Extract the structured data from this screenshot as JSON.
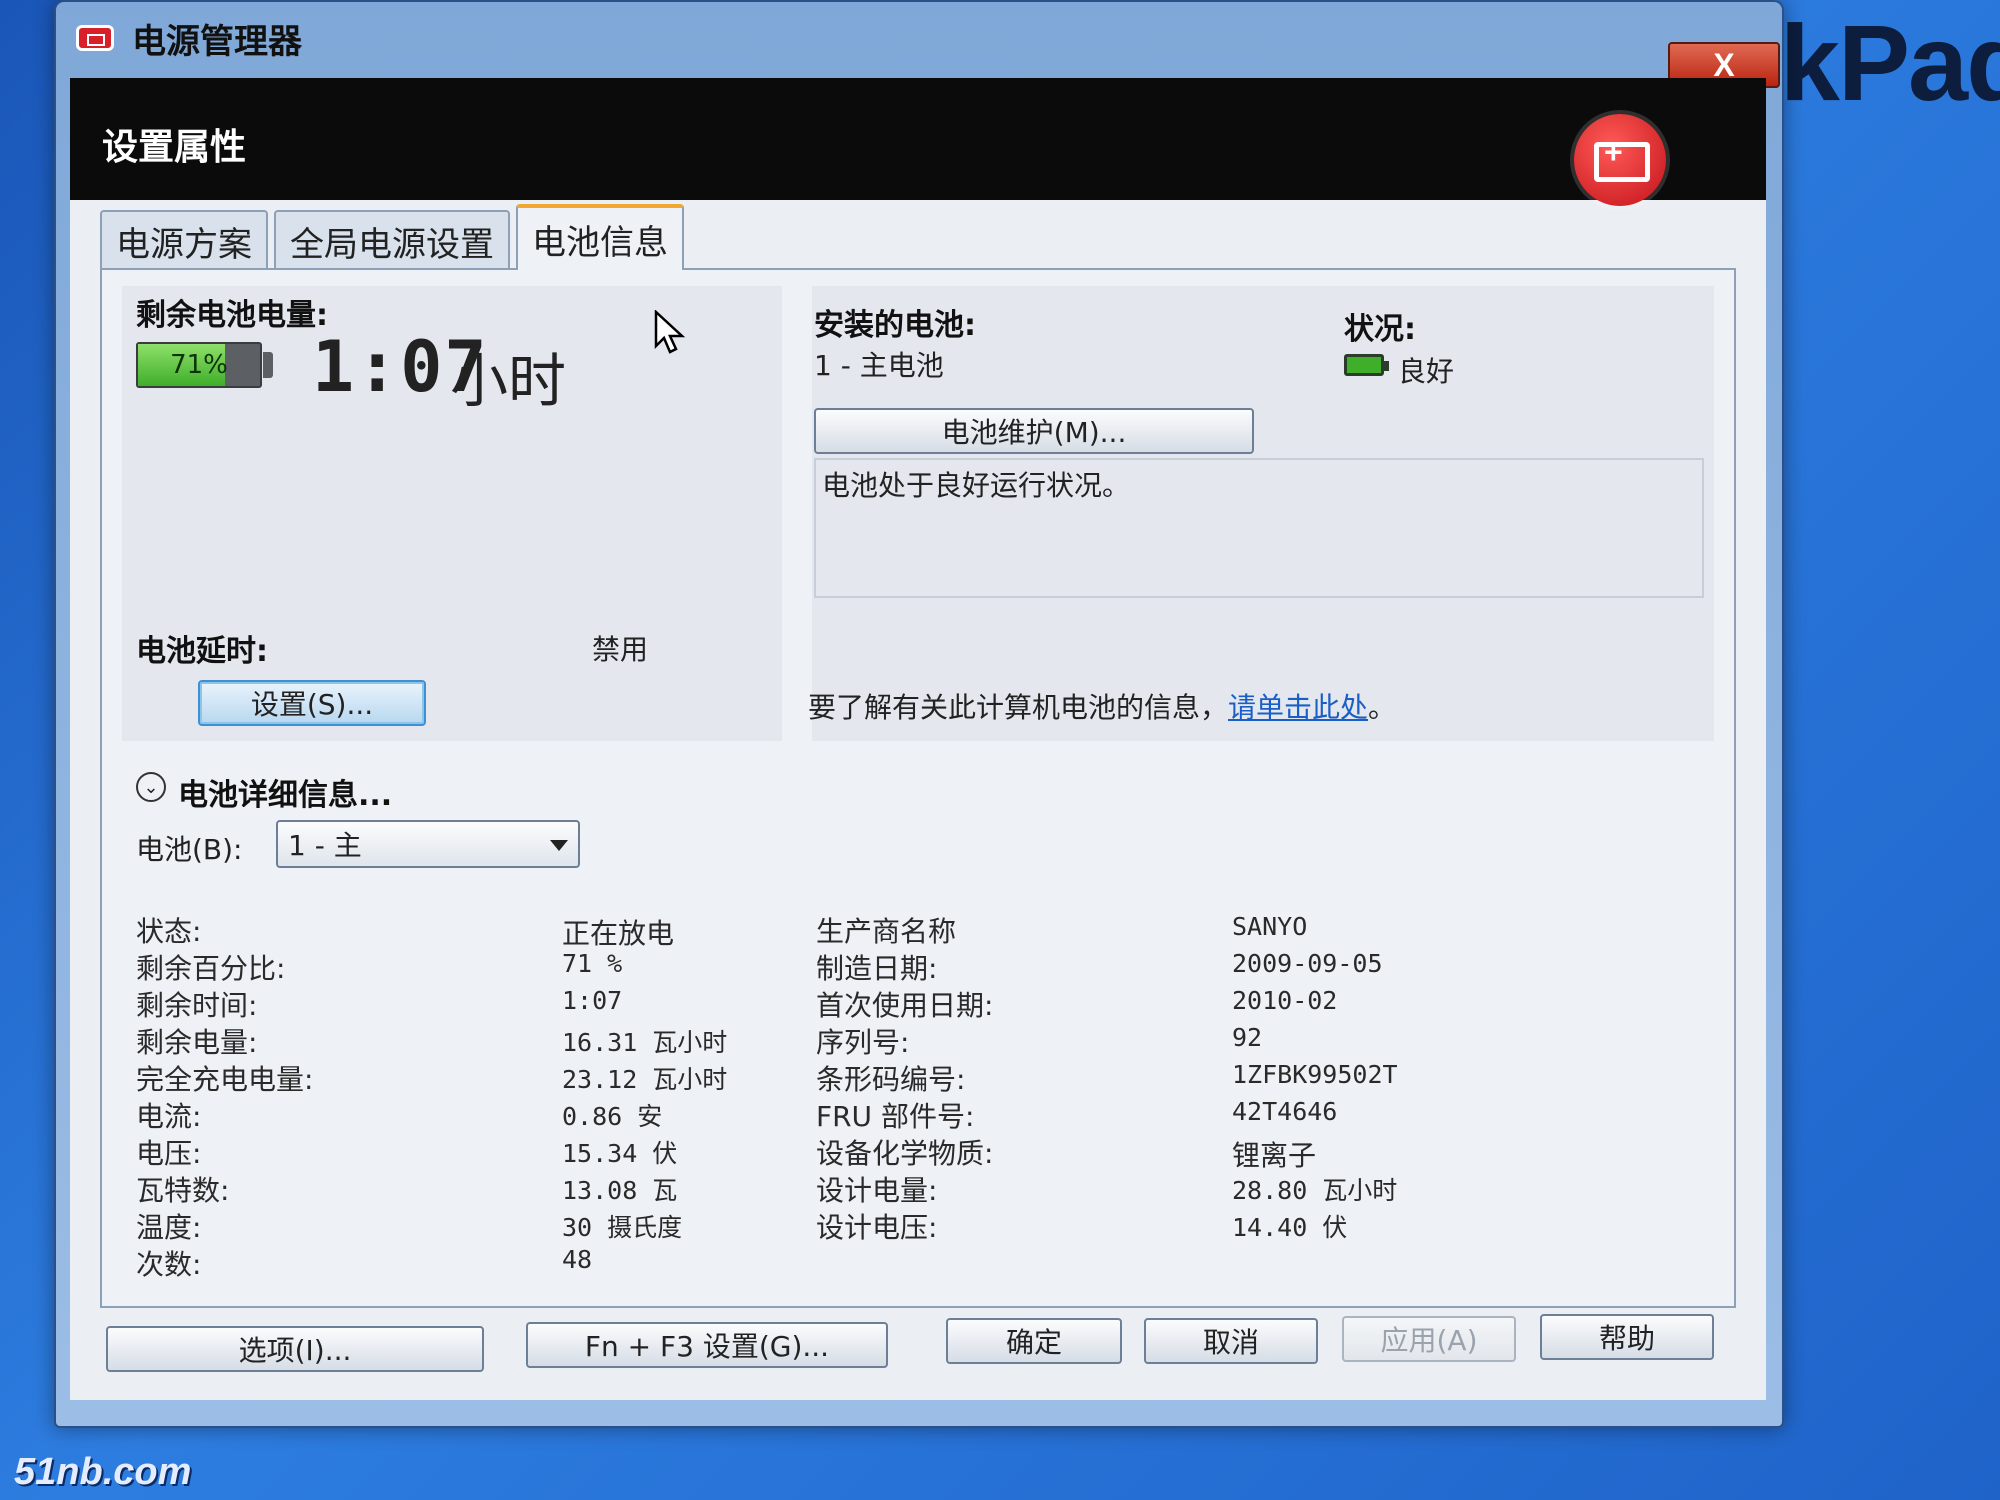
{
  "desktop": {
    "brand_text": "ThinkPad | Th",
    "watermark": "51nb.com"
  },
  "window": {
    "title": "电源管理器",
    "close_label": "X"
  },
  "header": {
    "title": "设置属性"
  },
  "tabs": [
    {
      "label": "电源方案"
    },
    {
      "label": "全局电源设置"
    },
    {
      "label": "电池信息"
    }
  ],
  "remaining": {
    "label": "剩余电池电量:",
    "percent_text": "71%",
    "percent_value": 0.71,
    "time": "1:07",
    "time_unit": "小时"
  },
  "installed": {
    "label": "安装的电池:",
    "value": "1 - 主电池"
  },
  "status": {
    "label": "状况:",
    "value": "良好"
  },
  "maintenance_button": "电池维护(M)...",
  "status_message": "电池处于良好运行状况。",
  "battery_delay": {
    "label": "电池延时:",
    "value": "禁用",
    "settings_button": "设置(S)..."
  },
  "info_link": {
    "prefix": "要了解有关此计算机电池的信息，",
    "link_text": "请单击此处",
    "suffix": "。"
  },
  "details": {
    "title": "电池详细信息...",
    "battery_select_label": "电池(B):",
    "battery_select_value": "1 - 主",
    "left": [
      {
        "k": "状态:",
        "v": "正在放电"
      },
      {
        "k": "剩余百分比:",
        "v": "71 %"
      },
      {
        "k": "剩余时间:",
        "v": "1:07"
      },
      {
        "k": "剩余电量:",
        "v": "16.31 瓦小时"
      },
      {
        "k": "完全充电电量:",
        "v": "23.12 瓦小时"
      },
      {
        "k": "电流:",
        "v": "0.86 安"
      },
      {
        "k": "电压:",
        "v": "15.34 伏"
      },
      {
        "k": "瓦特数:",
        "v": "13.08 瓦"
      },
      {
        "k": "温度:",
        "v": "30 摄氏度"
      },
      {
        "k": "次数:",
        "v": "48"
      }
    ],
    "right": [
      {
        "k": "生产商名称",
        "v": "SANYO"
      },
      {
        "k": "制造日期:",
        "v": "2009-09-05"
      },
      {
        "k": "首次使用日期:",
        "v": "2010-02"
      },
      {
        "k": "序列号:",
        "v": "92"
      },
      {
        "k": "条形码编号:",
        "v": "1ZFBK99502T"
      },
      {
        "k": "FRU 部件号:",
        "v": "42T4646"
      },
      {
        "k": "设备化学物质:",
        "v": "锂离子"
      },
      {
        "k": "设计电量:",
        "v": "28.80 瓦小时"
      },
      {
        "k": "设计电压:",
        "v": "14.40 伏"
      }
    ]
  },
  "footer": {
    "options": "选项(I)...",
    "fn_f3": "Fn + F3 设置(G)...",
    "ok": "确定",
    "cancel": "取消",
    "apply": "应用(A)",
    "help": "帮助"
  }
}
